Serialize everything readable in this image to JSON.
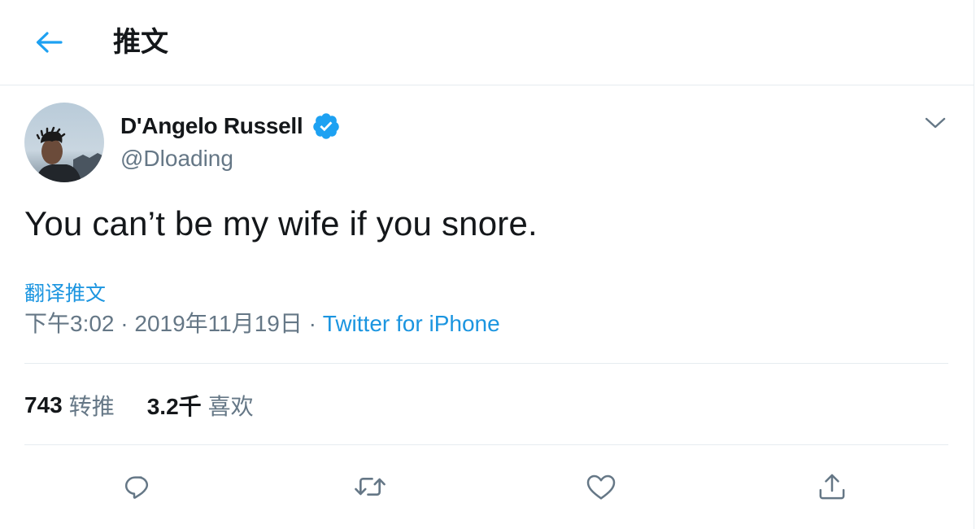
{
  "header": {
    "back_icon": "arrow-left-icon",
    "title": "推文"
  },
  "tweet": {
    "author": {
      "display_name": "D'Angelo Russell",
      "handle": "@Dloading",
      "verified": true
    },
    "text": "You can’t be my wife if you snore.",
    "translate_label": "翻译推文",
    "time": "下午3:02 · 2019年11月19日",
    "separator": "·",
    "source": "Twitter for iPhone"
  },
  "stats": {
    "retweets_count": "743",
    "retweets_label": "转推",
    "likes_count": "3.2千",
    "likes_label": "喜欢"
  },
  "actions": [
    {
      "name": "reply",
      "icon": "reply-icon"
    },
    {
      "name": "retweet",
      "icon": "retweet-icon"
    },
    {
      "name": "like",
      "icon": "heart-icon"
    },
    {
      "name": "share",
      "icon": "share-icon"
    }
  ],
  "colors": {
    "accent": "#1da1f2",
    "link": "#1b95e0",
    "text_primary": "#14171a",
    "text_secondary": "#657786",
    "border": "#e6ecf0"
  }
}
